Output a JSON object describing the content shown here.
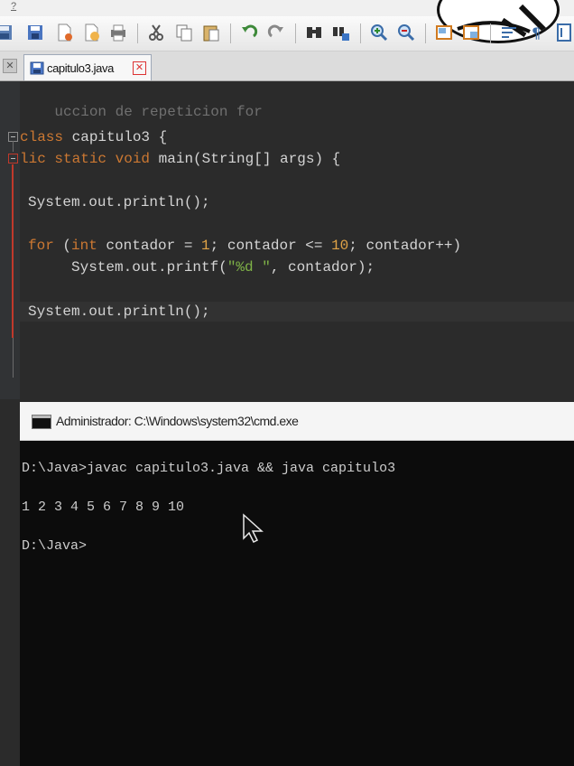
{
  "menu": {
    "help_label": "?"
  },
  "tab": {
    "filename": "capitulo3.java",
    "close_glyph": "✕",
    "left_close_glyph": "✕"
  },
  "editor": {
    "line1": {
      "comment": "uccion de repeticion for"
    },
    "line2": {
      "kw": "class",
      "rest": " capitulo3 {"
    },
    "line3": {
      "kw1": "lic static void",
      "rest": " main(String[] args) {"
    },
    "line4": {
      "text": "System.out.println();"
    },
    "line5": {
      "kw_for": "for",
      "p1": " (",
      "kw_int": "int",
      "p2": " contador = ",
      "n1": "1",
      "p3": "; contador <= ",
      "n2": "10",
      "p4": "; contador++)"
    },
    "line6": {
      "p1": "System.out.printf(",
      "str": "\"%d \"",
      "p2": ", contador);"
    },
    "line7": {
      "text": "System.out.println();"
    }
  },
  "cmd": {
    "title": "Administrador: C:\\Windows\\system32\\cmd.exe",
    "line1": "D:\\Java>javac capitulo3.java && java capitulo3",
    "line2": "1 2 3 4 5 6 7 8 9 10",
    "line3": "D:\\Java>"
  },
  "icons": {
    "toolbar": [
      "save-all-icon",
      "new-file-icon",
      "new-project-icon",
      "open-project-icon",
      "print-icon",
      "cut-icon",
      "copy-icon",
      "paste-icon",
      "undo-icon",
      "redo-icon",
      "find-icon",
      "replace-icon",
      "zoom-in-icon",
      "zoom-out-icon",
      "toggle-view-icon",
      "window-icon",
      "word-wrap-icon",
      "pilcrow-icon"
    ]
  },
  "colors": {
    "keyword": "#cc7832",
    "comment": "#707070",
    "number": "#e0a347",
    "string": "#7fb347",
    "editor_bg": "#2b2b2b",
    "cmd_bg": "#0c0c0c"
  }
}
